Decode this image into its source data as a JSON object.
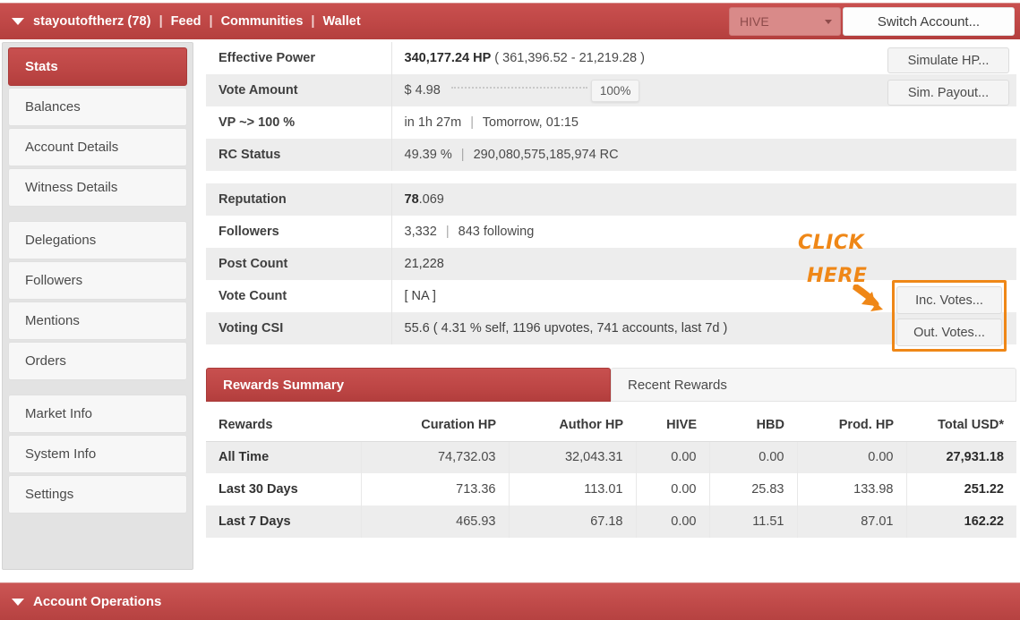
{
  "topbar": {
    "user": "stayoutoftherz (78)",
    "sep": "|",
    "links": [
      {
        "label": "Feed"
      },
      {
        "label": "Communities"
      },
      {
        "label": "Wallet"
      }
    ],
    "chain_select": "HIVE",
    "switch_account_label": "Switch Account...",
    "accent_color": "#bf4746"
  },
  "sidebar": {
    "groups": [
      {
        "items": [
          {
            "label": "Stats",
            "active": true
          },
          {
            "label": "Balances",
            "active": false
          },
          {
            "label": "Account Details",
            "active": false
          },
          {
            "label": "Witness Details",
            "active": false
          }
        ]
      },
      {
        "items": [
          {
            "label": "Delegations",
            "active": false
          },
          {
            "label": "Followers",
            "active": false
          },
          {
            "label": "Mentions",
            "active": false
          },
          {
            "label": "Orders",
            "active": false
          }
        ]
      },
      {
        "items": [
          {
            "label": "Market Info",
            "active": false
          },
          {
            "label": "System Info",
            "active": false
          },
          {
            "label": "Settings",
            "active": false
          }
        ]
      }
    ]
  },
  "stats": {
    "rows": [
      {
        "label": "Effective Power",
        "value_strong": "340,177.24 HP",
        "value_rest": "( 361,396.52 - 21,219.28 )"
      },
      {
        "label": "Vote Amount",
        "amount": "$ 4.98",
        "percent": "100%"
      },
      {
        "label": "VP ~> 100 %",
        "value_a": "in 1h 27m",
        "value_b": "Tomorrow, 01:15"
      },
      {
        "label": "RC Status",
        "value_a": "49.39 %",
        "value_b": "290,080,575,185,974 RC"
      },
      {
        "label": "Reputation",
        "value_strong": "78",
        "value_rest": ".069"
      },
      {
        "label": "Followers",
        "value_a": "3,332",
        "value_b": "843 following"
      },
      {
        "label": "Post Count",
        "value_plain": "21,228"
      },
      {
        "label": "Vote Count",
        "value_plain": "[ NA ]"
      },
      {
        "label": "Voting CSI",
        "value_plain": "55.6 ( 4.31 % self, 1196 upvotes, 741 accounts, last 7d )"
      }
    ]
  },
  "action_buttons": {
    "simulate_hp": "Simulate HP...",
    "sim_payout": "Sim. Payout...",
    "inc_votes": "Inc. Votes...",
    "out_votes": "Out. Votes..."
  },
  "annotation": {
    "line1": "CLICK",
    "line2": "HERE",
    "color": "#ef8717"
  },
  "tabs": {
    "items": [
      {
        "label": "Rewards Summary",
        "active": true
      },
      {
        "label": "Recent Rewards",
        "active": false
      }
    ]
  },
  "rewards_table": {
    "headers": [
      "Rewards",
      "Curation HP",
      "Author HP",
      "HIVE",
      "HBD",
      "Prod. HP",
      "Total USD*"
    ],
    "rows": [
      {
        "cells": [
          "All Time",
          "74,732.03",
          "32,043.31",
          "0.00",
          "0.00",
          "0.00",
          "27,931.18"
        ]
      },
      {
        "cells": [
          "Last 30 Days",
          "713.36",
          "113.01",
          "0.00",
          "25.83",
          "133.98",
          "251.22"
        ]
      },
      {
        "cells": [
          "Last 7 Days",
          "465.93",
          "67.18",
          "0.00",
          "11.51",
          "87.01",
          "162.22"
        ]
      }
    ]
  },
  "bottombar": {
    "label": "Account Operations"
  }
}
